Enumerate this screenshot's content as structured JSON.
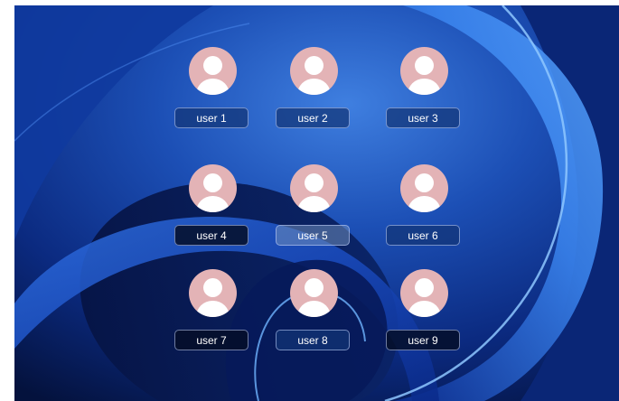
{
  "users": [
    {
      "label": "user 1",
      "avatar_icon": "user-avatar-icon"
    },
    {
      "label": "user 2",
      "avatar_icon": "user-avatar-icon"
    },
    {
      "label": "user 3",
      "avatar_icon": "user-avatar-icon"
    },
    {
      "label": "user 4",
      "avatar_icon": "user-avatar-icon"
    },
    {
      "label": "user 5",
      "avatar_icon": "user-avatar-icon"
    },
    {
      "label": "user 6",
      "avatar_icon": "user-avatar-icon"
    },
    {
      "label": "user 7",
      "avatar_icon": "user-avatar-icon"
    },
    {
      "label": "user 8",
      "avatar_icon": "user-avatar-icon"
    },
    {
      "label": "user 9",
      "avatar_icon": "user-avatar-icon"
    }
  ],
  "colors": {
    "avatar_background": "#e3b3b6",
    "avatar_silhouette": "#ffffff",
    "wallpaper_base": "#0a1f6b",
    "wallpaper_highlight": "#4f9dff"
  }
}
